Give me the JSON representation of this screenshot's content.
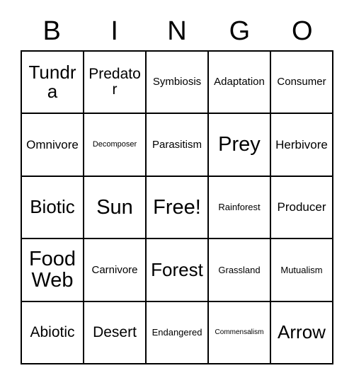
{
  "card": {
    "header": {
      "letters": [
        "B",
        "I",
        "N",
        "G",
        "O"
      ]
    },
    "colors": {
      "text": "#000000",
      "background": "#ffffff",
      "border": "#000000"
    },
    "grid": {
      "columns": 5,
      "rows": 5,
      "free_space": "Free!",
      "free_space_position": "row3-col3",
      "cells": [
        [
          {
            "text": "Tundra",
            "size": "lg"
          },
          {
            "text": "Predator",
            "size": "md"
          },
          {
            "text": "Symbiosis",
            "size": "xs"
          },
          {
            "text": "Adaptation",
            "size": "xs"
          },
          {
            "text": "Consumer",
            "size": "xs"
          }
        ],
        [
          {
            "text": "Omnivore",
            "size": "sm"
          },
          {
            "text": "Decomposer",
            "size": "tiny"
          },
          {
            "text": "Parasitism",
            "size": "xs"
          },
          {
            "text": "Prey",
            "size": "xl"
          },
          {
            "text": "Herbivore",
            "size": "sm"
          }
        ],
        [
          {
            "text": "Biotic",
            "size": "lg"
          },
          {
            "text": "Sun",
            "size": "xl"
          },
          {
            "text": "Free!",
            "size": "xl"
          },
          {
            "text": "Rainforest",
            "size": "xxs"
          },
          {
            "text": "Producer",
            "size": "sm"
          }
        ],
        [
          {
            "text": "Food Web",
            "size": "xl"
          },
          {
            "text": "Carnivore",
            "size": "xs"
          },
          {
            "text": "Forest",
            "size": "lg"
          },
          {
            "text": "Grassland",
            "size": "xxs"
          },
          {
            "text": "Mutualism",
            "size": "xxs"
          }
        ],
        [
          {
            "text": "Abiotic",
            "size": "md"
          },
          {
            "text": "Desert",
            "size": "md"
          },
          {
            "text": "Endangered",
            "size": "xxs"
          },
          {
            "text": "Commensalism",
            "size": "micro"
          },
          {
            "text": "Arrow",
            "size": "lg"
          }
        ]
      ]
    }
  }
}
